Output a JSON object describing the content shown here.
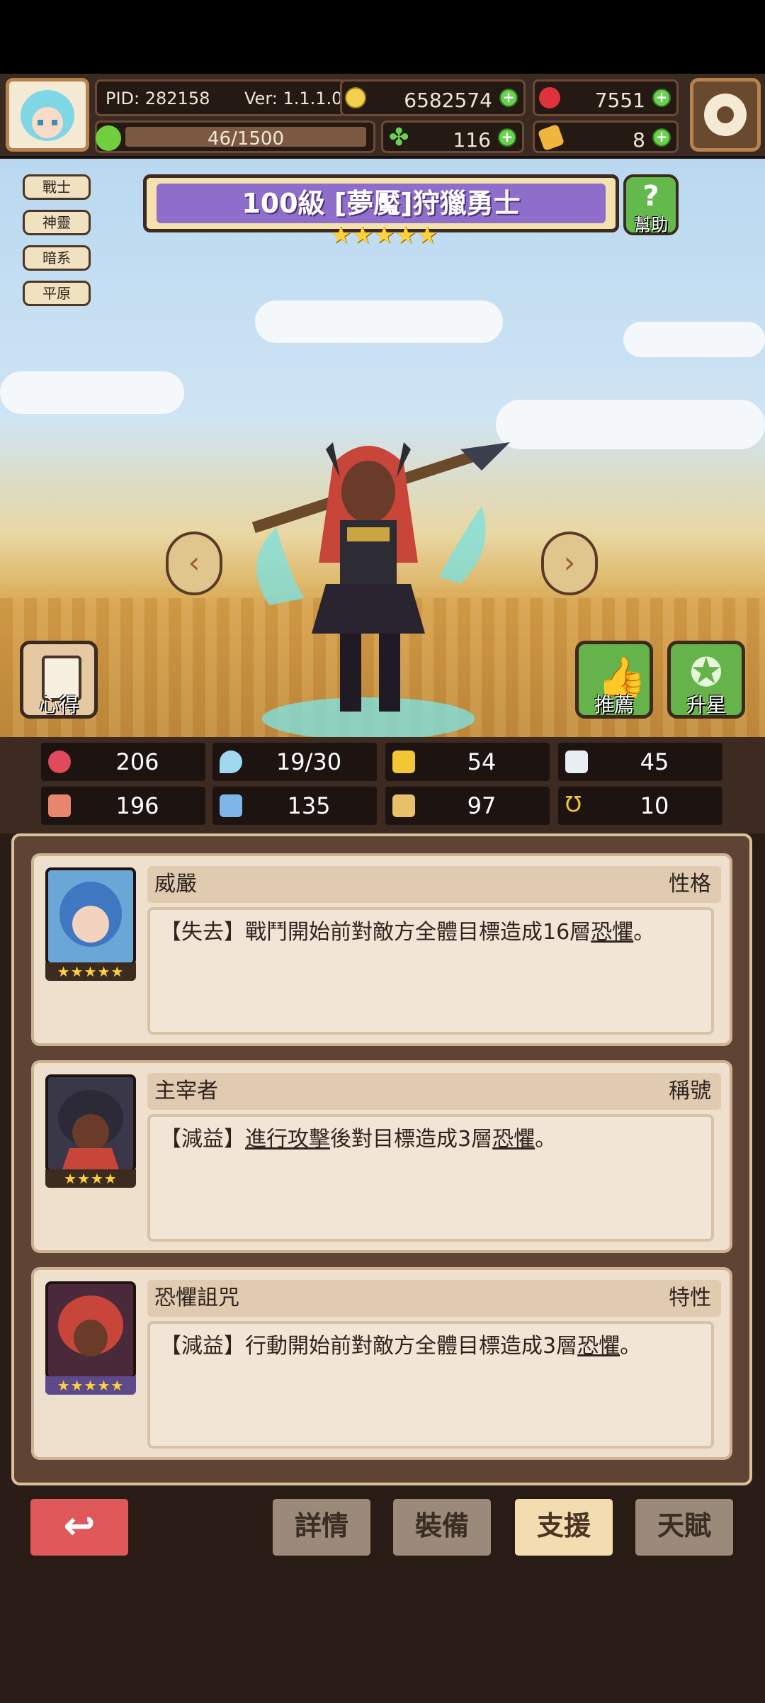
{
  "header": {
    "pid": "PID: 282158",
    "version": "Ver: 1.1.1.0",
    "gold": "6582574",
    "gems": "7551",
    "stamina": "46/1500",
    "clover": "116",
    "tickets": "8"
  },
  "tags": [
    "戰士",
    "神靈",
    "暗系",
    "平原"
  ],
  "hero": {
    "title": "100級 [夢魘]狩獵勇士",
    "stars": "★★★★★"
  },
  "buttons": {
    "help": "幫助",
    "insight": "心得",
    "recommend": "推薦",
    "star_up": "升星"
  },
  "stats": [
    {
      "icon": "heart-icon",
      "value": "206"
    },
    {
      "icon": "water-drop-icon",
      "value": "19/30"
    },
    {
      "icon": "shield-icon",
      "value": "54"
    },
    {
      "icon": "feather-icon",
      "value": "45"
    },
    {
      "icon": "fist-icon",
      "value": "196"
    },
    {
      "icon": "book-icon",
      "value": "135"
    },
    {
      "icon": "boot-icon",
      "value": "97"
    },
    {
      "icon": "magnet-icon",
      "value": "10"
    }
  ],
  "cards": [
    {
      "name": "威嚴",
      "type": "性格",
      "stars": "★★★★★",
      "text_a": "【失去】戰鬥開始前對敵方全體目標造成16層",
      "text_ul": "恐懼",
      "text_b": "。"
    },
    {
      "name": "主宰者",
      "type": "稱號",
      "stars": "★★★★",
      "text_a": "【減益】",
      "text_ul1": "進行攻擊",
      "text_mid": "後對目標造成3層",
      "text_ul2": "恐懼",
      "text_b": "。"
    },
    {
      "name": "恐懼詛咒",
      "type": "特性",
      "stars": "★★★★★",
      "text_a": "【減益】行動開始前對敵方全體目標造成3層",
      "text_ul": "恐懼",
      "text_b": "。"
    }
  ],
  "nav": {
    "back": "↩",
    "details": "詳情",
    "equipment": "裝備",
    "support": "支援",
    "talent": "天賦"
  }
}
